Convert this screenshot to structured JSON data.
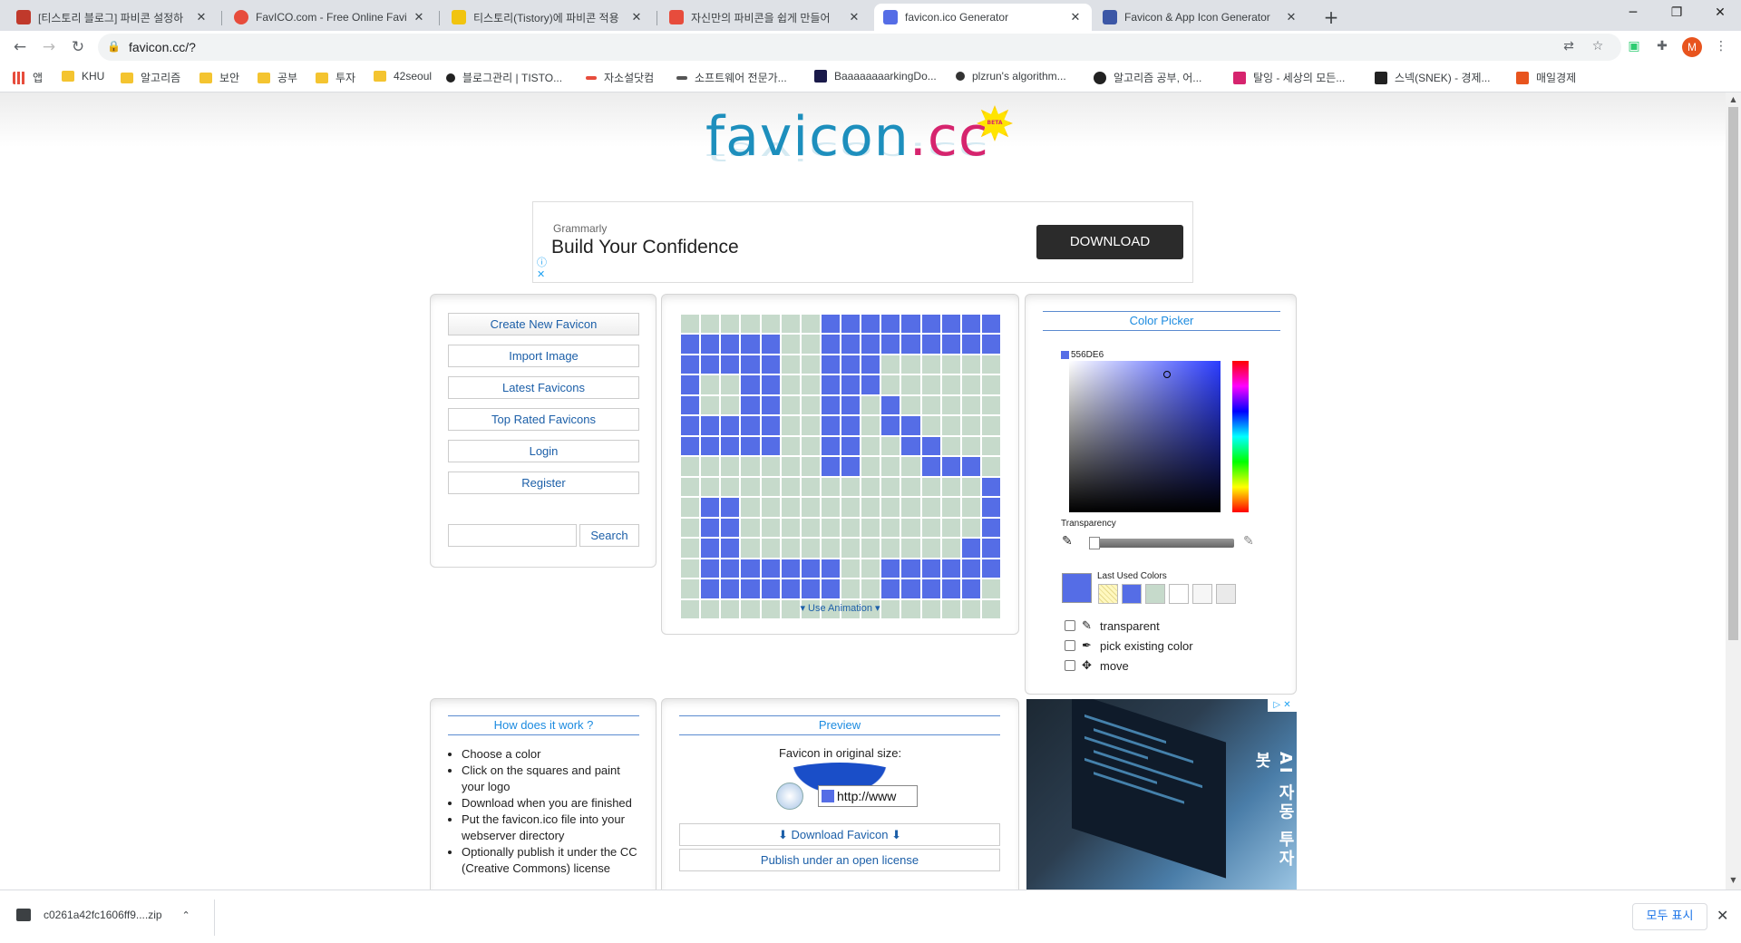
{
  "browser": {
    "tabs": [
      {
        "title": "[티스토리 블로그] 파비콘 설정하",
        "color": "#c0392b"
      },
      {
        "title": "FavICO.com - Free Online Favic",
        "color": "#e74c3c"
      },
      {
        "title": "티스토리(Tistory)에 파비콘 적용",
        "color": "#f1c40f"
      },
      {
        "title": "자신만의 파비콘을 쉽게 만들어",
        "color": "#e74c3c"
      },
      {
        "title": "favicon.ico Generator",
        "color": "#556de6"
      },
      {
        "title": "Favicon & App Icon Generator",
        "color": "#3c57a6"
      }
    ],
    "url": "favicon.cc/?",
    "profile_initial": "M",
    "bookmarks": [
      {
        "label": "앱",
        "kind": "apps"
      },
      {
        "label": "KHU",
        "kind": "folder"
      },
      {
        "label": "알고리즘",
        "kind": "folder"
      },
      {
        "label": "보안",
        "kind": "folder"
      },
      {
        "label": "공부",
        "kind": "folder"
      },
      {
        "label": "투자",
        "kind": "folder"
      },
      {
        "label": "42seoul",
        "kind": "folder"
      },
      {
        "label": "블로그관리 | TISTO...",
        "kind": "site"
      },
      {
        "label": "자소설닷컴",
        "kind": "site"
      },
      {
        "label": "소프트웨어 전문가...",
        "kind": "site"
      },
      {
        "label": "BaaaaaaaarkingDo...",
        "kind": "site"
      },
      {
        "label": "plzrun's algorithm...",
        "kind": "site"
      },
      {
        "label": "알고리즘 공부, 어...",
        "kind": "site"
      },
      {
        "label": "탈잉 - 세상의 모든...",
        "kind": "site"
      },
      {
        "label": "스넥(SNEK) - 경제...",
        "kind": "site"
      },
      {
        "label": "매일경제",
        "kind": "site"
      }
    ]
  },
  "logo": {
    "part1": "favicon",
    "part2": ".cc",
    "badge": "BETA"
  },
  "ad_top": {
    "brand": "Grammarly",
    "headline": "Build Your Confidence",
    "button": "DOWNLOAD"
  },
  "menu": {
    "items": [
      "Create New Favicon",
      "Import Image",
      "Latest Favicons",
      "Top Rated Favicons",
      "Login",
      "Register"
    ],
    "search_button": "Search"
  },
  "editor": {
    "animation_label": "▾ Use Animation ▾",
    "on_color": "#556de6",
    "off_color": "#c6dacb",
    "pixels": [
      "0000000111111111",
      "1111100111111111",
      "1111100111000000",
      "1001100111000000",
      "1001100110100000",
      "1111100110110000",
      "1111100110011000",
      "0000000110001110",
      "0000000000000001",
      "0110000000000001",
      "0110000000000001",
      "0110000000000011",
      "0111111100111111",
      "0111111100111110",
      "0000000000000000"
    ]
  },
  "color_picker": {
    "title": "Color Picker",
    "hex": "556DE6",
    "transparency_label": "Transparency",
    "last_used_label": "Last Used Colors",
    "last_used": [
      "#fff8c0",
      "#556de6",
      "#c6dacb",
      "#ffffff",
      "#f6f6f6",
      "#eaeaea"
    ],
    "options": [
      {
        "label": "transparent",
        "icon": "eraser-icon",
        "glyph": "✎"
      },
      {
        "label": "pick existing color",
        "icon": "eyedropper-icon",
        "glyph": "✒"
      },
      {
        "label": "move",
        "icon": "move-icon",
        "glyph": "✥"
      }
    ]
  },
  "how": {
    "title": "How does it work ?",
    "steps": [
      "Choose a color",
      "Click on the squares and paint your logo",
      "Download when you are finished",
      "Put the favicon.ico file into your webserver directory",
      "Optionally publish it under the CC (Creative Commons) license"
    ]
  },
  "preview": {
    "title": "Preview",
    "label": "Favicon in original size:",
    "address_text": "http://www",
    "download_button": "⬇ Download Favicon ⬇",
    "publish_button": "Publish under an open license"
  },
  "ad_side": {
    "text": "AI 자동 투자 봇"
  },
  "downloads": {
    "file": "c0261a42fc1606ff9....zip",
    "show_all": "모두 표시"
  }
}
